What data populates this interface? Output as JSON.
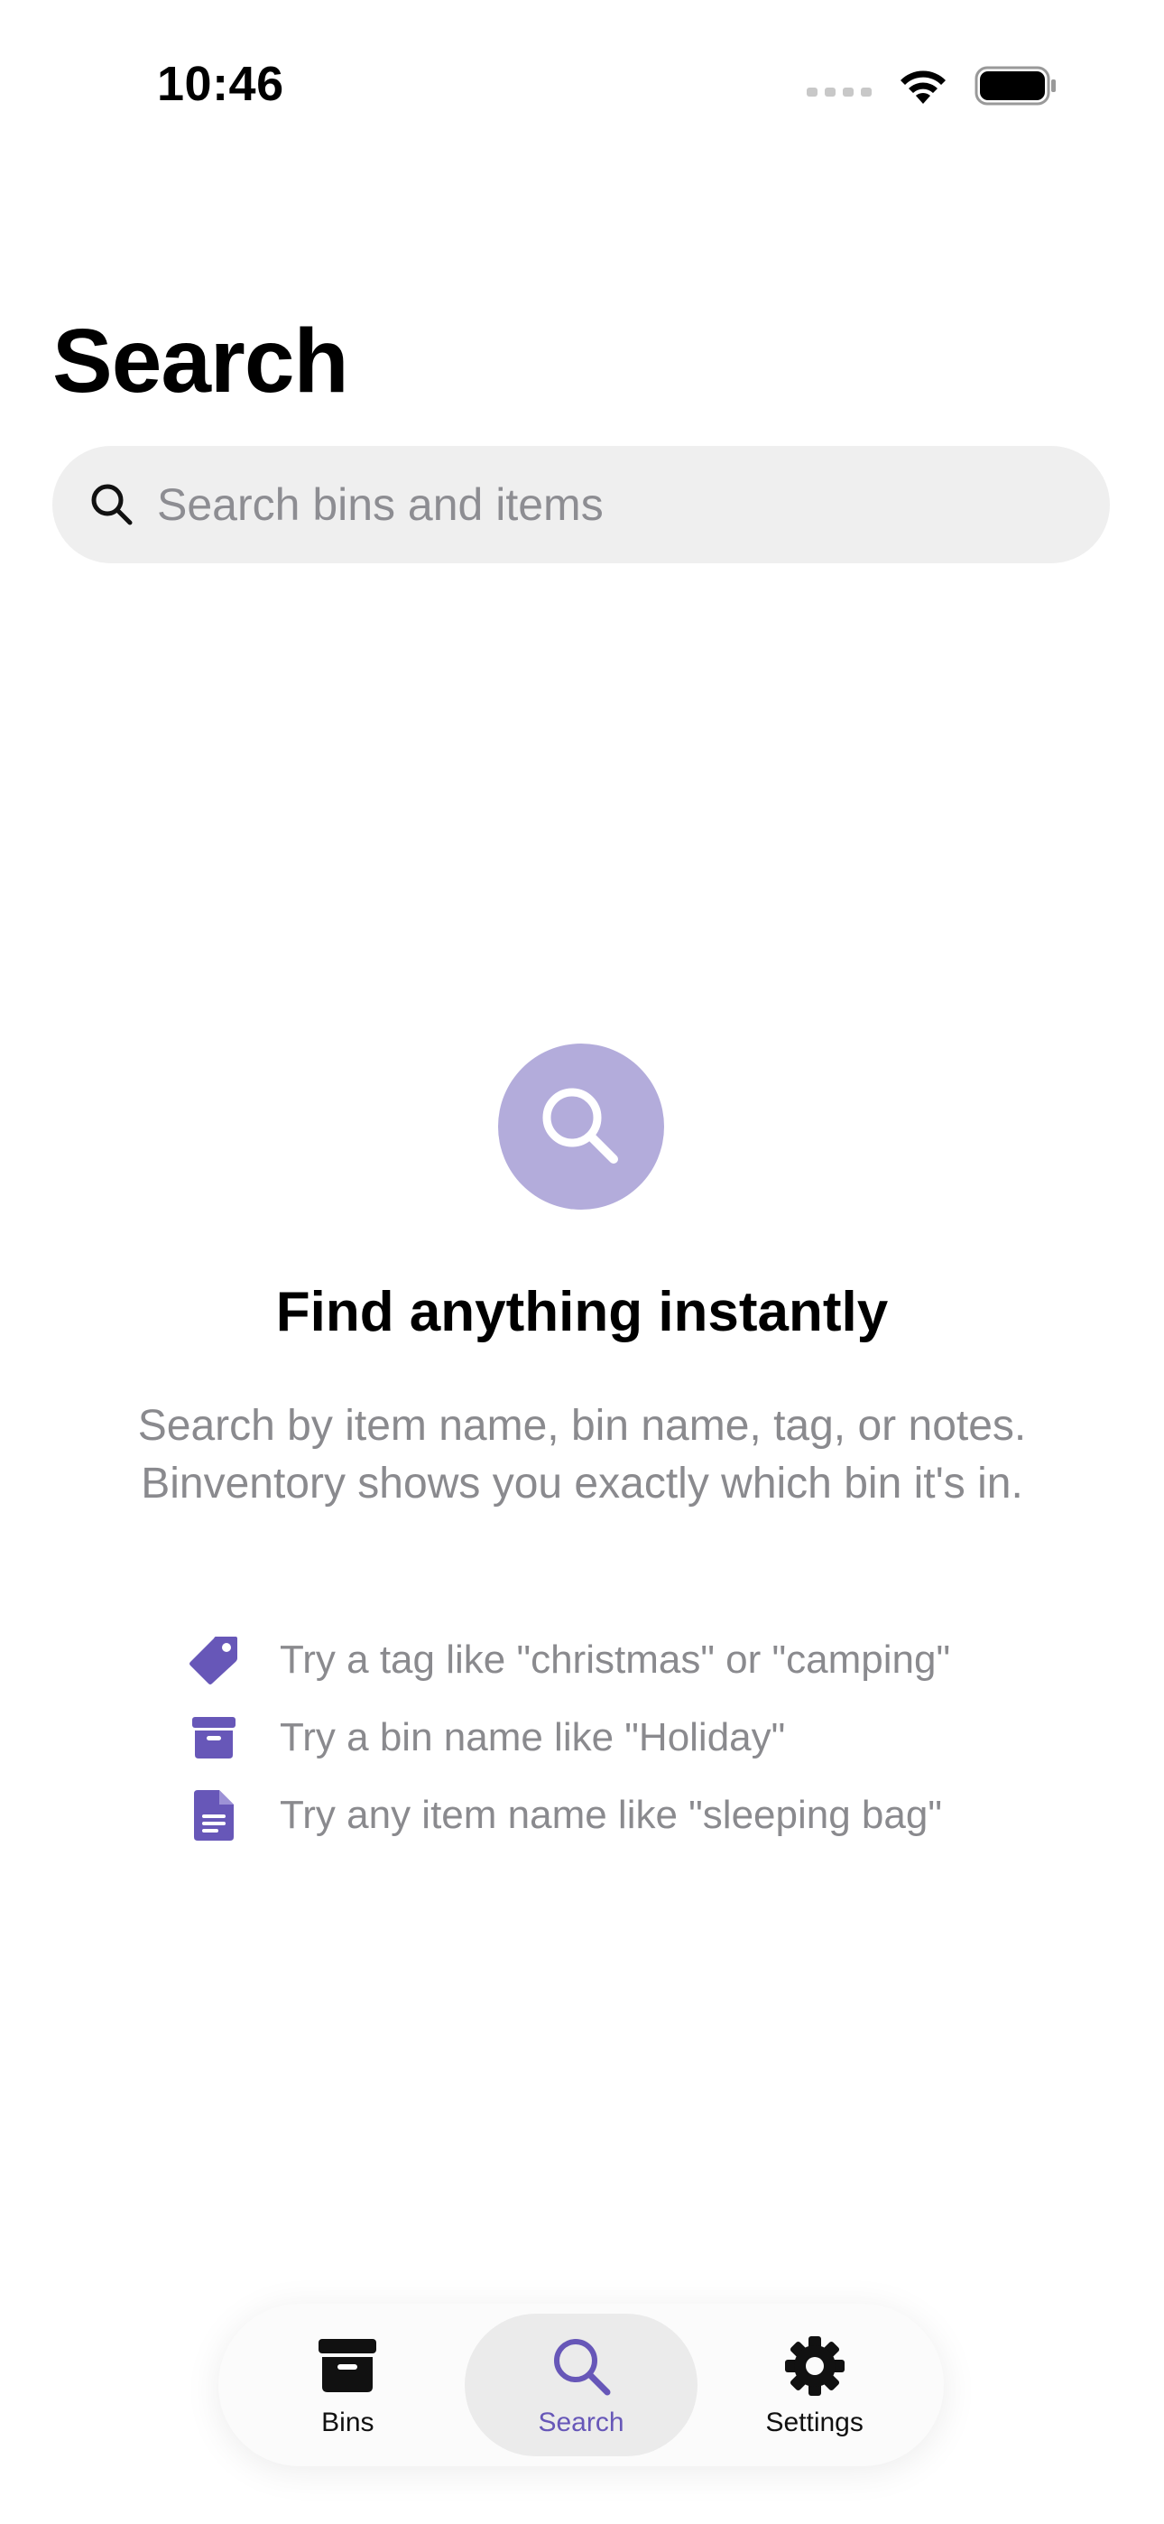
{
  "status_bar": {
    "time": "10:46"
  },
  "page": {
    "title": "Search"
  },
  "search": {
    "placeholder": "Search bins and items",
    "value": ""
  },
  "empty_state": {
    "icon": "magnifying-glass-icon",
    "title": "Find anything instantly",
    "description_lines": [
      "Search by item name, bin name, tag, or notes.",
      "Binventory shows you exactly which bin it's in."
    ],
    "tips": [
      {
        "icon": "tag-icon",
        "text": "Try a tag like \"christmas\" or \"camping\""
      },
      {
        "icon": "archive-box-icon",
        "text": "Try a bin name like \"Holiday\""
      },
      {
        "icon": "document-icon",
        "text": "Try any item name like \"sleeping bag\""
      }
    ]
  },
  "tab_bar": {
    "tabs": [
      {
        "label": "Bins",
        "icon": "archive-box-icon",
        "active": false
      },
      {
        "label": "Search",
        "icon": "magnifying-glass-icon",
        "active": true
      },
      {
        "label": "Settings",
        "icon": "gear-icon",
        "active": false
      }
    ]
  },
  "colors": {
    "accent": "#6757b8",
    "accent_light": "#b3acdb",
    "secondary_text": "#8a8a8e",
    "field_background": "#efefef"
  }
}
